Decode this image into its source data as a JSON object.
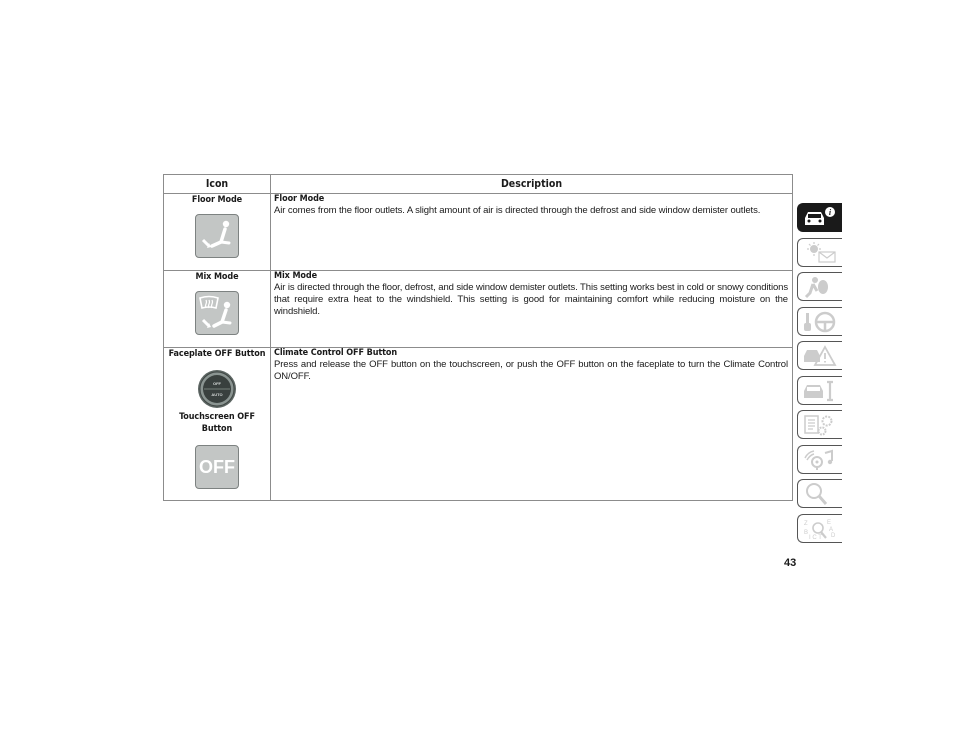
{
  "table": {
    "headers": {
      "icon": "Icon",
      "description": "Description"
    },
    "rows": [
      {
        "icon_labels": [
          "Floor Mode"
        ],
        "icon_names": [
          "floor-mode-icon"
        ],
        "title": "Floor Mode",
        "text": "Air comes from the floor outlets. A slight amount of air is directed through the defrost and side window demister outlets."
      },
      {
        "icon_labels": [
          "Mix Mode"
        ],
        "icon_names": [
          "mix-mode-icon"
        ],
        "title": "Mix Mode",
        "text": "Air is directed through the floor, defrost, and side window demister outlets. This setting works best in cold or snowy conditions that require extra heat to the windshield. This setting is good for maintaining comfort while reducing moisture on the windshield."
      },
      {
        "icon_labels": [
          "Faceplate OFF Button",
          "Touchscreen OFF Button"
        ],
        "icon_names": [
          "faceplate-off-knob-icon",
          "touchscreen-off-button-icon"
        ],
        "title": "Climate Control OFF Button",
        "text": "Press and release the OFF button on the touchscreen, or push the OFF button on the faceplate to turn the Climate Control ON/OFF.",
        "knob_text_top": "OFF",
        "knob_text_bottom": "AUTO",
        "touchscreen_button_text": "OFF"
      }
    ]
  },
  "side_tabs": [
    {
      "name": "vehicle-info-tab",
      "icon": "car-info-icon",
      "active": true
    },
    {
      "name": "instrument-cluster-tab",
      "icon": "sun-envelope-icon",
      "active": false
    },
    {
      "name": "safety-tab",
      "icon": "airbag-person-icon",
      "active": false
    },
    {
      "name": "starting-operating-tab",
      "icon": "key-steering-wheel-icon",
      "active": false
    },
    {
      "name": "emergency-tab",
      "icon": "car-warning-icon",
      "active": false
    },
    {
      "name": "servicing-tab",
      "icon": "car-wrench-icon",
      "active": false
    },
    {
      "name": "specifications-tab",
      "icon": "list-gear-icon",
      "active": false
    },
    {
      "name": "multimedia-tab",
      "icon": "radio-music-icon",
      "active": false
    },
    {
      "name": "customer-assistance-tab",
      "icon": "magnifier-icon",
      "active": false
    },
    {
      "name": "index-tab",
      "icon": "alphabet-index-icon",
      "active": false
    }
  ],
  "page_number": "43"
}
